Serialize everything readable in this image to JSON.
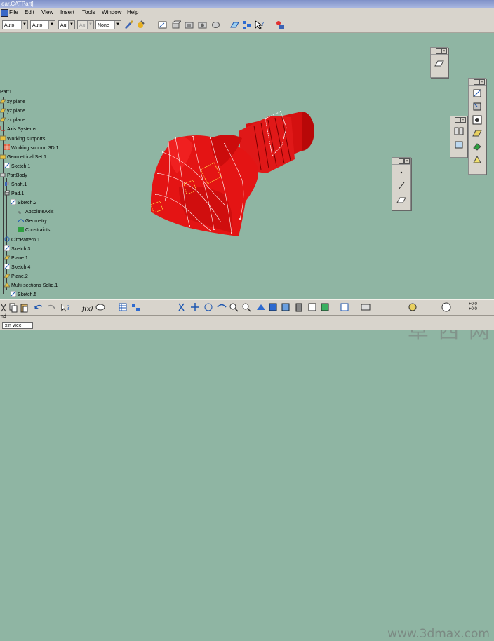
{
  "window": {
    "title": "ear.CATPart]"
  },
  "menu": {
    "items": [
      "File",
      "Edit",
      "View",
      "Insert",
      "Tools",
      "Window",
      "Help"
    ]
  },
  "toolbar": {
    "combos": [
      {
        "value": "Auto"
      },
      {
        "value": "Auto"
      },
      {
        "value": "Aul"
      },
      {
        "value": "Aul"
      },
      {
        "value": "None"
      }
    ]
  },
  "tree": {
    "items": [
      {
        "label": "Part1",
        "icon": "part-icon"
      },
      {
        "label": "xy plane",
        "icon": "plane-icon"
      },
      {
        "label": "yz plane",
        "icon": "plane-icon"
      },
      {
        "label": "zx plane",
        "icon": "plane-icon"
      },
      {
        "label": "Axis Systems",
        "icon": "axis-icon"
      },
      {
        "label": "Working supports",
        "icon": "support-icon"
      },
      {
        "label": "Working support 3D.1",
        "icon": "grid-icon"
      },
      {
        "label": "Geometrical Set.1",
        "icon": "geoset-icon"
      },
      {
        "label": "Sketch.1",
        "icon": "sketch-icon"
      },
      {
        "label": "PartBody",
        "icon": "body-icon"
      },
      {
        "label": "Shaft.1",
        "icon": "shaft-icon"
      },
      {
        "label": "Pad.1",
        "icon": "pad-icon"
      },
      {
        "label": "Sketch.2",
        "icon": "sketch-icon"
      },
      {
        "label": "AbsoluteAxis",
        "icon": "axis-icon"
      },
      {
        "label": "Geometry",
        "icon": "geometry-icon"
      },
      {
        "label": "Constraints",
        "icon": "constraint-icon"
      },
      {
        "label": "CircPattern.1",
        "icon": "pattern-icon"
      },
      {
        "label": "Sketch.3",
        "icon": "sketch-icon"
      },
      {
        "label": "Plane.1",
        "icon": "plane-icon"
      },
      {
        "label": "Sketch.4",
        "icon": "sketch-icon"
      },
      {
        "label": "Plane.2",
        "icon": "plane-icon"
      },
      {
        "label": "Multi-sections Solid.1",
        "icon": "multisection-icon"
      },
      {
        "label": "Sketch.5",
        "icon": "sketch-icon"
      }
    ]
  },
  "status": {
    "prompt": "nd",
    "command": "xin viec"
  },
  "watermark": {
    "brand": "草 西 网",
    "url": "www.3dmax.com"
  },
  "compass": {
    "line1": "+0.0",
    "line2": "+0.0"
  },
  "colors": {
    "model": "#e01010",
    "background": "#8fb5a3",
    "toolbar": "#d8d4cc"
  }
}
